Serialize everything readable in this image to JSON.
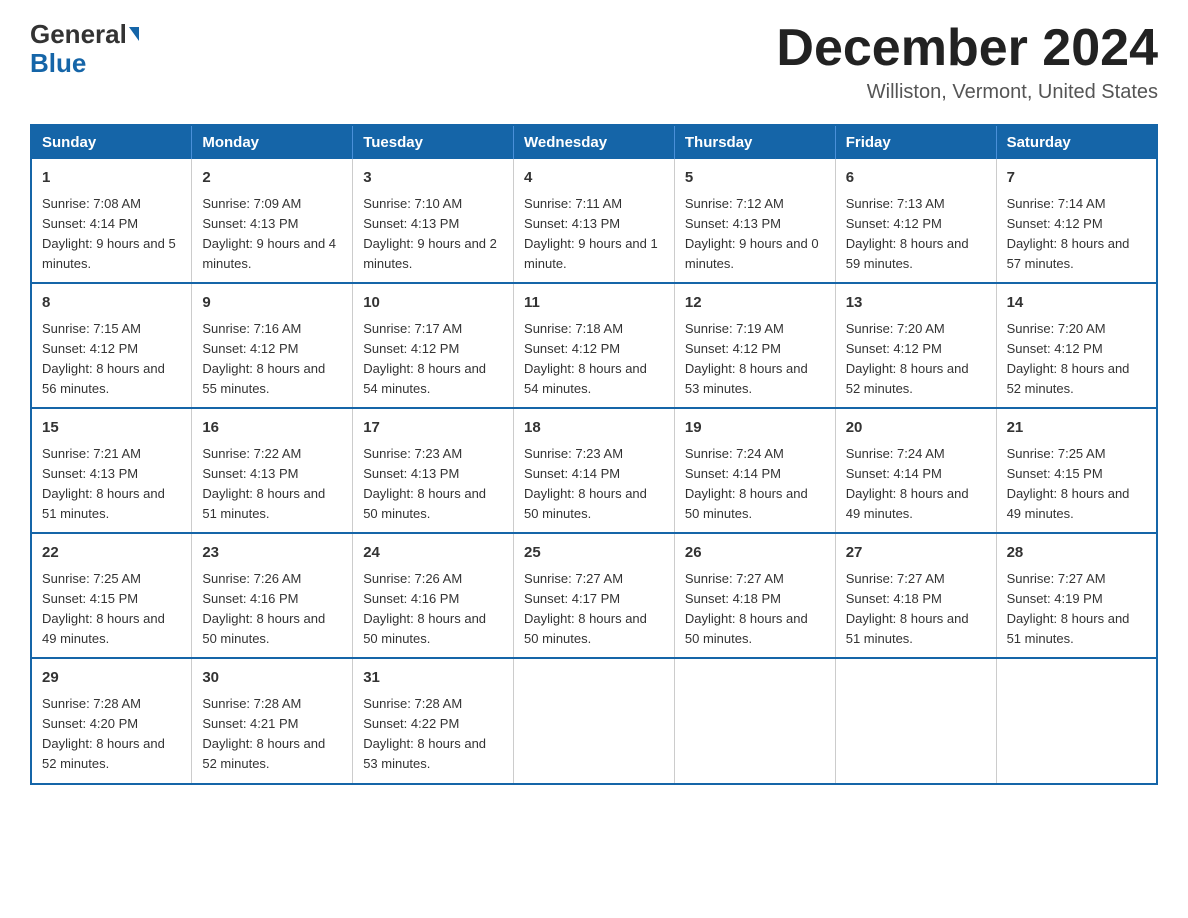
{
  "logo": {
    "general": "General",
    "arrow": "▲",
    "blue": "Blue"
  },
  "header": {
    "month_title": "December 2024",
    "location": "Williston, Vermont, United States"
  },
  "calendar": {
    "days_of_week": [
      "Sunday",
      "Monday",
      "Tuesday",
      "Wednesday",
      "Thursday",
      "Friday",
      "Saturday"
    ],
    "weeks": [
      [
        {
          "day": "1",
          "sunrise": "7:08 AM",
          "sunset": "4:14 PM",
          "daylight": "9 hours and 5 minutes."
        },
        {
          "day": "2",
          "sunrise": "7:09 AM",
          "sunset": "4:13 PM",
          "daylight": "9 hours and 4 minutes."
        },
        {
          "day": "3",
          "sunrise": "7:10 AM",
          "sunset": "4:13 PM",
          "daylight": "9 hours and 2 minutes."
        },
        {
          "day": "4",
          "sunrise": "7:11 AM",
          "sunset": "4:13 PM",
          "daylight": "9 hours and 1 minute."
        },
        {
          "day": "5",
          "sunrise": "7:12 AM",
          "sunset": "4:13 PM",
          "daylight": "9 hours and 0 minutes."
        },
        {
          "day": "6",
          "sunrise": "7:13 AM",
          "sunset": "4:12 PM",
          "daylight": "8 hours and 59 minutes."
        },
        {
          "day": "7",
          "sunrise": "7:14 AM",
          "sunset": "4:12 PM",
          "daylight": "8 hours and 57 minutes."
        }
      ],
      [
        {
          "day": "8",
          "sunrise": "7:15 AM",
          "sunset": "4:12 PM",
          "daylight": "8 hours and 56 minutes."
        },
        {
          "day": "9",
          "sunrise": "7:16 AM",
          "sunset": "4:12 PM",
          "daylight": "8 hours and 55 minutes."
        },
        {
          "day": "10",
          "sunrise": "7:17 AM",
          "sunset": "4:12 PM",
          "daylight": "8 hours and 54 minutes."
        },
        {
          "day": "11",
          "sunrise": "7:18 AM",
          "sunset": "4:12 PM",
          "daylight": "8 hours and 54 minutes."
        },
        {
          "day": "12",
          "sunrise": "7:19 AM",
          "sunset": "4:12 PM",
          "daylight": "8 hours and 53 minutes."
        },
        {
          "day": "13",
          "sunrise": "7:20 AM",
          "sunset": "4:12 PM",
          "daylight": "8 hours and 52 minutes."
        },
        {
          "day": "14",
          "sunrise": "7:20 AM",
          "sunset": "4:12 PM",
          "daylight": "8 hours and 52 minutes."
        }
      ],
      [
        {
          "day": "15",
          "sunrise": "7:21 AM",
          "sunset": "4:13 PM",
          "daylight": "8 hours and 51 minutes."
        },
        {
          "day": "16",
          "sunrise": "7:22 AM",
          "sunset": "4:13 PM",
          "daylight": "8 hours and 51 minutes."
        },
        {
          "day": "17",
          "sunrise": "7:23 AM",
          "sunset": "4:13 PM",
          "daylight": "8 hours and 50 minutes."
        },
        {
          "day": "18",
          "sunrise": "7:23 AM",
          "sunset": "4:14 PM",
          "daylight": "8 hours and 50 minutes."
        },
        {
          "day": "19",
          "sunrise": "7:24 AM",
          "sunset": "4:14 PM",
          "daylight": "8 hours and 50 minutes."
        },
        {
          "day": "20",
          "sunrise": "7:24 AM",
          "sunset": "4:14 PM",
          "daylight": "8 hours and 49 minutes."
        },
        {
          "day": "21",
          "sunrise": "7:25 AM",
          "sunset": "4:15 PM",
          "daylight": "8 hours and 49 minutes."
        }
      ],
      [
        {
          "day": "22",
          "sunrise": "7:25 AM",
          "sunset": "4:15 PM",
          "daylight": "8 hours and 49 minutes."
        },
        {
          "day": "23",
          "sunrise": "7:26 AM",
          "sunset": "4:16 PM",
          "daylight": "8 hours and 50 minutes."
        },
        {
          "day": "24",
          "sunrise": "7:26 AM",
          "sunset": "4:16 PM",
          "daylight": "8 hours and 50 minutes."
        },
        {
          "day": "25",
          "sunrise": "7:27 AM",
          "sunset": "4:17 PM",
          "daylight": "8 hours and 50 minutes."
        },
        {
          "day": "26",
          "sunrise": "7:27 AM",
          "sunset": "4:18 PM",
          "daylight": "8 hours and 50 minutes."
        },
        {
          "day": "27",
          "sunrise": "7:27 AM",
          "sunset": "4:18 PM",
          "daylight": "8 hours and 51 minutes."
        },
        {
          "day": "28",
          "sunrise": "7:27 AM",
          "sunset": "4:19 PM",
          "daylight": "8 hours and 51 minutes."
        }
      ],
      [
        {
          "day": "29",
          "sunrise": "7:28 AM",
          "sunset": "4:20 PM",
          "daylight": "8 hours and 52 minutes."
        },
        {
          "day": "30",
          "sunrise": "7:28 AM",
          "sunset": "4:21 PM",
          "daylight": "8 hours and 52 minutes."
        },
        {
          "day": "31",
          "sunrise": "7:28 AM",
          "sunset": "4:22 PM",
          "daylight": "8 hours and 53 minutes."
        },
        null,
        null,
        null,
        null
      ]
    ]
  }
}
